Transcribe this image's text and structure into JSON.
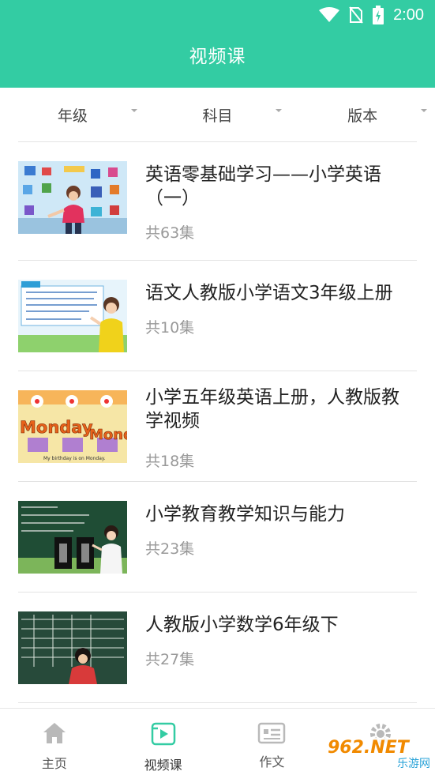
{
  "status_bar": {
    "time": "2:00"
  },
  "header": {
    "title": "视频课"
  },
  "filters": [
    {
      "label": "年级"
    },
    {
      "label": "科目"
    },
    {
      "label": "版本"
    }
  ],
  "courses": [
    {
      "title": "英语零基础学习——小学英语（一）",
      "count": "共63集"
    },
    {
      "title": "语文人教版小学语文3年级上册",
      "count": "共10集"
    },
    {
      "title": "小学五年级英语上册，人教版教学视频",
      "count": "共18集"
    },
    {
      "title": "小学教育教学知识与能力",
      "count": "共23集"
    },
    {
      "title": "人教版小学数学6年级下",
      "count": "共27集"
    }
  ],
  "thumb_text": {
    "monday": "Monday",
    "caption": "My birthday is on Monday."
  },
  "tabs": [
    {
      "label": "主页",
      "icon": "home-icon"
    },
    {
      "label": "视频课",
      "icon": "video-icon"
    },
    {
      "label": "作文",
      "icon": "essay-icon"
    },
    {
      "label": "",
      "icon": "settings-icon"
    }
  ],
  "watermark": {
    "main": "962.NET",
    "sub": "乐游网"
  },
  "colors": {
    "accent": "#33cca3"
  }
}
